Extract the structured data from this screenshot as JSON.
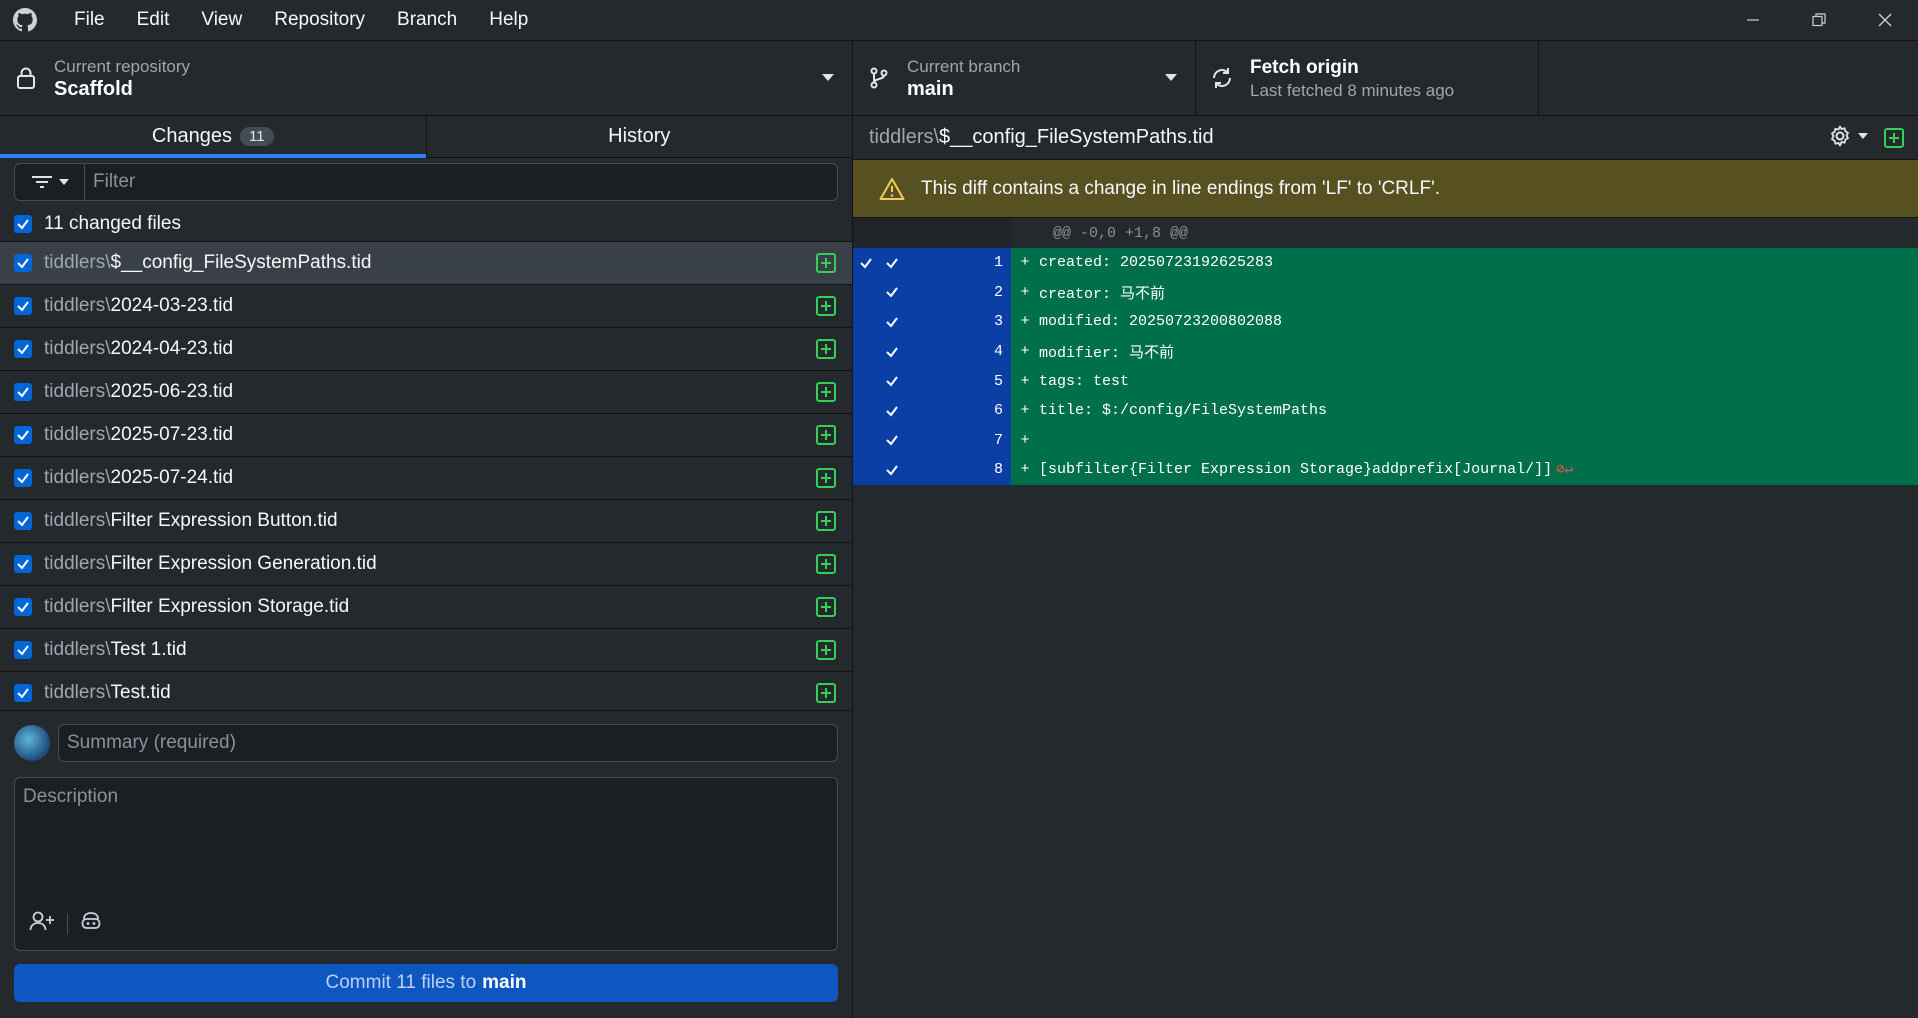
{
  "menu": [
    "File",
    "Edit",
    "View",
    "Repository",
    "Branch",
    "Help"
  ],
  "toolbar": {
    "repo_label": "Current repository",
    "repo_value": "Scaffold",
    "branch_label": "Current branch",
    "branch_value": "main",
    "fetch_label": "Fetch origin",
    "fetch_status": "Last fetched 8 minutes ago"
  },
  "tabs": {
    "changes_label": "Changes",
    "changes_count": "11",
    "history_label": "History"
  },
  "filter": {
    "placeholder": "Filter"
  },
  "select_all_label": "11 changed files",
  "files": [
    {
      "dir": "tiddlers\\",
      "name": "$__config_FileSystemPaths.tid",
      "selected": true
    },
    {
      "dir": "tiddlers\\",
      "name": "2024-03-23.tid"
    },
    {
      "dir": "tiddlers\\",
      "name": "2024-04-23.tid"
    },
    {
      "dir": "tiddlers\\",
      "name": "2025-06-23.tid"
    },
    {
      "dir": "tiddlers\\",
      "name": "2025-07-23.tid"
    },
    {
      "dir": "tiddlers\\",
      "name": "2025-07-24.tid"
    },
    {
      "dir": "tiddlers\\",
      "name": "Filter Expression Button.tid"
    },
    {
      "dir": "tiddlers\\",
      "name": "Filter Expression Generation.tid"
    },
    {
      "dir": "tiddlers\\",
      "name": "Filter Expression Storage.tid"
    },
    {
      "dir": "tiddlers\\",
      "name": "Test 1.tid"
    },
    {
      "dir": "tiddlers\\",
      "name": "Test.tid"
    }
  ],
  "commit": {
    "summary_placeholder": "Summary (required)",
    "description_placeholder": "Description",
    "button_prefix": "Commit 11 files to",
    "button_branch": "main"
  },
  "diff": {
    "path_dir": "tiddlers\\",
    "path_name": "$__config_FileSystemPaths.tid",
    "banner": "This diff contains a change in line endings from 'LF' to 'CRLF'.",
    "hunk_header": "@@ -0,0 +1,8 @@",
    "lines": [
      {
        "num": "1",
        "text": "created: 20250723192625283"
      },
      {
        "num": "2",
        "text": "creator: 马不前"
      },
      {
        "num": "3",
        "text": "modified: 20250723200802088"
      },
      {
        "num": "4",
        "text": "modifier: 马不前"
      },
      {
        "num": "5",
        "text": "tags: test"
      },
      {
        "num": "6",
        "text": "title: $:/config/FileSystemPaths"
      },
      {
        "num": "7",
        "text": ""
      },
      {
        "num": "8",
        "text": "[subfilter{Filter Expression Storage}addprefix[Journal/]]"
      }
    ]
  },
  "colors": {
    "accent": "#2f81f7",
    "added_line": "#00704a",
    "banner": "#575021",
    "commit_button": "#0e56c0"
  }
}
